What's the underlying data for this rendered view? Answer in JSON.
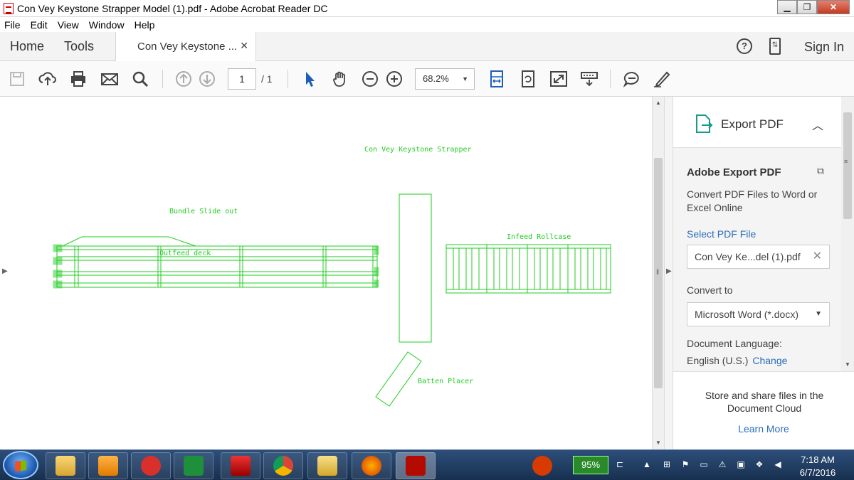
{
  "window": {
    "title": "Con Vey Keystone Strapper Model (1).pdf - Adobe Acrobat Reader DC",
    "buttons": {
      "minimize": "▁",
      "maximize": "❐",
      "close": "✕"
    }
  },
  "menubar": [
    "File",
    "Edit",
    "View",
    "Window",
    "Help"
  ],
  "tabs": {
    "home": "Home",
    "tools": "Tools",
    "document": "Con Vey Keystone ...",
    "close": "✕",
    "sign_in": "Sign In",
    "help": "?",
    "mobile": "⇅"
  },
  "toolbar": {
    "page_current": "1",
    "page_total": "/ 1",
    "zoom": "68.2%",
    "icons": [
      "save-icon",
      "cloud-upload-icon",
      "print-icon",
      "mail-icon",
      "search-icon",
      "page-up-icon",
      "page-down-icon",
      "select-cursor-icon",
      "hand-icon",
      "zoom-out-icon",
      "zoom-in-icon",
      "fit-page-icon",
      "rotate-icon",
      "fullscreen-icon",
      "keyboard-icon",
      "comment-icon",
      "highlight-pen-icon"
    ]
  },
  "drawing": {
    "title": "Con Vey Keystone Strapper",
    "labels": {
      "bundle": "Bundle Slide out",
      "outfeed": "Outfeed deck",
      "infeed": "Infeed Rollcase",
      "batten": "Batten Placer"
    },
    "line_color": "#22cc22"
  },
  "right_panel": {
    "header": "Export PDF",
    "title": "Adobe Export PDF",
    "description": "Convert PDF Files to Word or Excel Online",
    "select_link": "Select PDF File",
    "file_name": "Con Vey Ke...del (1).pdf",
    "convert_label": "Convert to",
    "convert_value": "Microsoft Word (*.docx)",
    "language_label": "Document Language:",
    "language_value": "English (U.S.)",
    "change_link": "Change",
    "footer_text": "Store and share files in the Document Cloud",
    "learn_more": "Learn More"
  },
  "taskbar": {
    "battery": "95%",
    "time": "7:18 AM",
    "date": "6/7/2016"
  },
  "colors": {
    "accent_blue": "#2a6ebb",
    "taskbar": "#1f3b62",
    "close_red": "#c43b22"
  }
}
